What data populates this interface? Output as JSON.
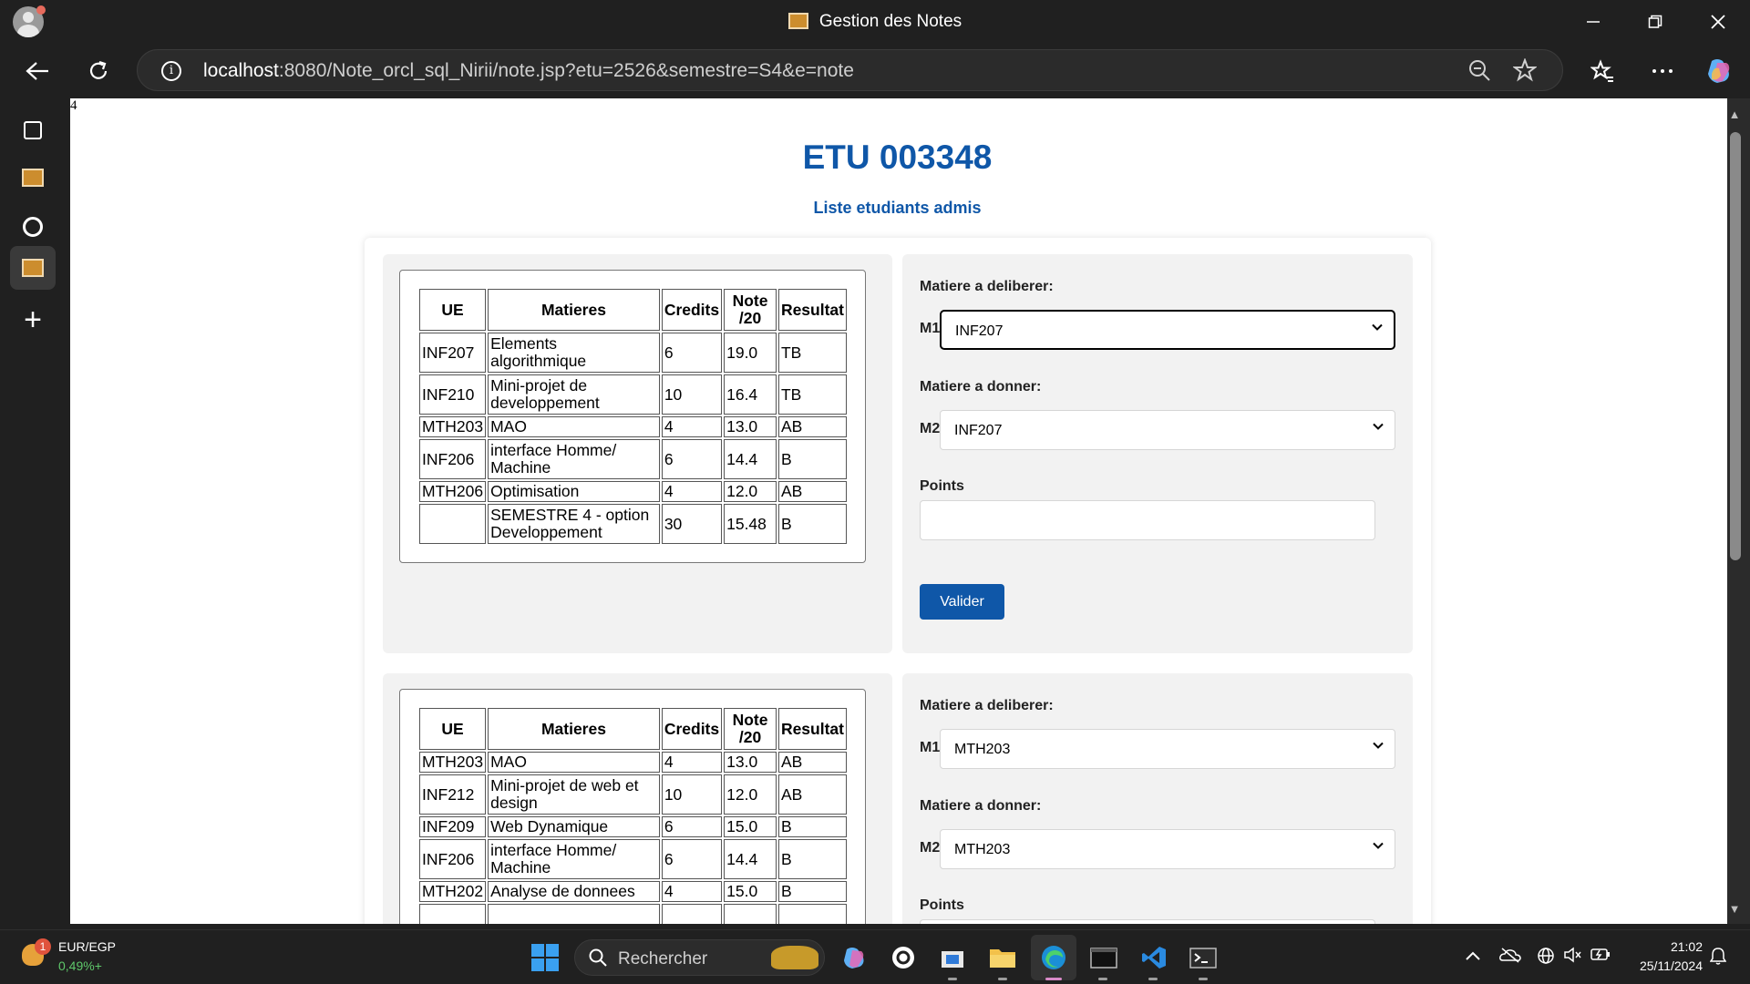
{
  "browser": {
    "window_title": "Gestion des Notes",
    "url_host": "localhost",
    "url_rest": ":8080/Note_orcl_sql_Nirii/note.jsp?etu=2526&semestre=S4&e=note"
  },
  "page": {
    "stray_text": "4",
    "title": "ETU 003348",
    "admis_link": "Liste etudiants admis",
    "headers": {
      "ue": "UE",
      "matieres": "Matieres",
      "credits": "Credits",
      "note": "Note /20",
      "resultat": "Resultat"
    },
    "blocks": [
      {
        "rows": [
          {
            "ue": "INF207",
            "matiere": "Elements algorithmique",
            "credits": "6",
            "note": "19.0",
            "resultat": "TB"
          },
          {
            "ue": "INF210",
            "matiere": "Mini-projet de developpement",
            "credits": "10",
            "note": "16.4",
            "resultat": "TB"
          },
          {
            "ue": "MTH203",
            "matiere": "MAO",
            "credits": "4",
            "note": "13.0",
            "resultat": "AB"
          },
          {
            "ue": "INF206",
            "matiere": "interface Homme/ Machine",
            "credits": "6",
            "note": "14.4",
            "resultat": "B"
          },
          {
            "ue": "MTH206",
            "matiere": "Optimisation",
            "credits": "4",
            "note": "12.0",
            "resultat": "AB"
          },
          {
            "ue": "",
            "matiere": "SEMESTRE 4 - option Developpement",
            "credits": "30",
            "note": "15.48",
            "resultat": "B"
          }
        ],
        "form": {
          "label_m1_section": "Matiere a deliberer:",
          "m1_label": "M1",
          "m1_value": "INF207",
          "label_m2_section": "Matiere a donner:",
          "m2_label": "M2",
          "m2_value": "INF207",
          "points_label": "Points",
          "points_value": "",
          "submit_label": "Valider"
        }
      },
      {
        "rows": [
          {
            "ue": "MTH203",
            "matiere": "MAO",
            "credits": "4",
            "note": "13.0",
            "resultat": "AB"
          },
          {
            "ue": "INF212",
            "matiere": "Mini-projet de web et design",
            "credits": "10",
            "note": "12.0",
            "resultat": "AB"
          },
          {
            "ue": "INF209",
            "matiere": "Web Dynamique",
            "credits": "6",
            "note": "15.0",
            "resultat": "B"
          },
          {
            "ue": "INF206",
            "matiere": "interface Homme/ Machine",
            "credits": "6",
            "note": "14.4",
            "resultat": "B"
          },
          {
            "ue": "MTH202",
            "matiere": "Analyse de donnees",
            "credits": "4",
            "note": "15.0",
            "resultat": "B"
          }
        ],
        "form": {
          "label_m1_section": "Matiere a deliberer:",
          "m1_label": "M1",
          "m1_value": "MTH203",
          "label_m2_section": "Matiere a donner:",
          "m2_label": "M2",
          "m2_value": "MTH203",
          "points_label": "Points"
        }
      }
    ]
  },
  "taskbar": {
    "widget_badge": "1",
    "ticker": "EUR/EGP",
    "ticker_change": "0,49%+",
    "search_placeholder": "Rechercher",
    "time": "21:02",
    "date": "25/11/2024"
  },
  "colors": {
    "accent": "#0f57a8",
    "card_bg": "#f2f2f2",
    "chrome_bg": "#202020"
  }
}
